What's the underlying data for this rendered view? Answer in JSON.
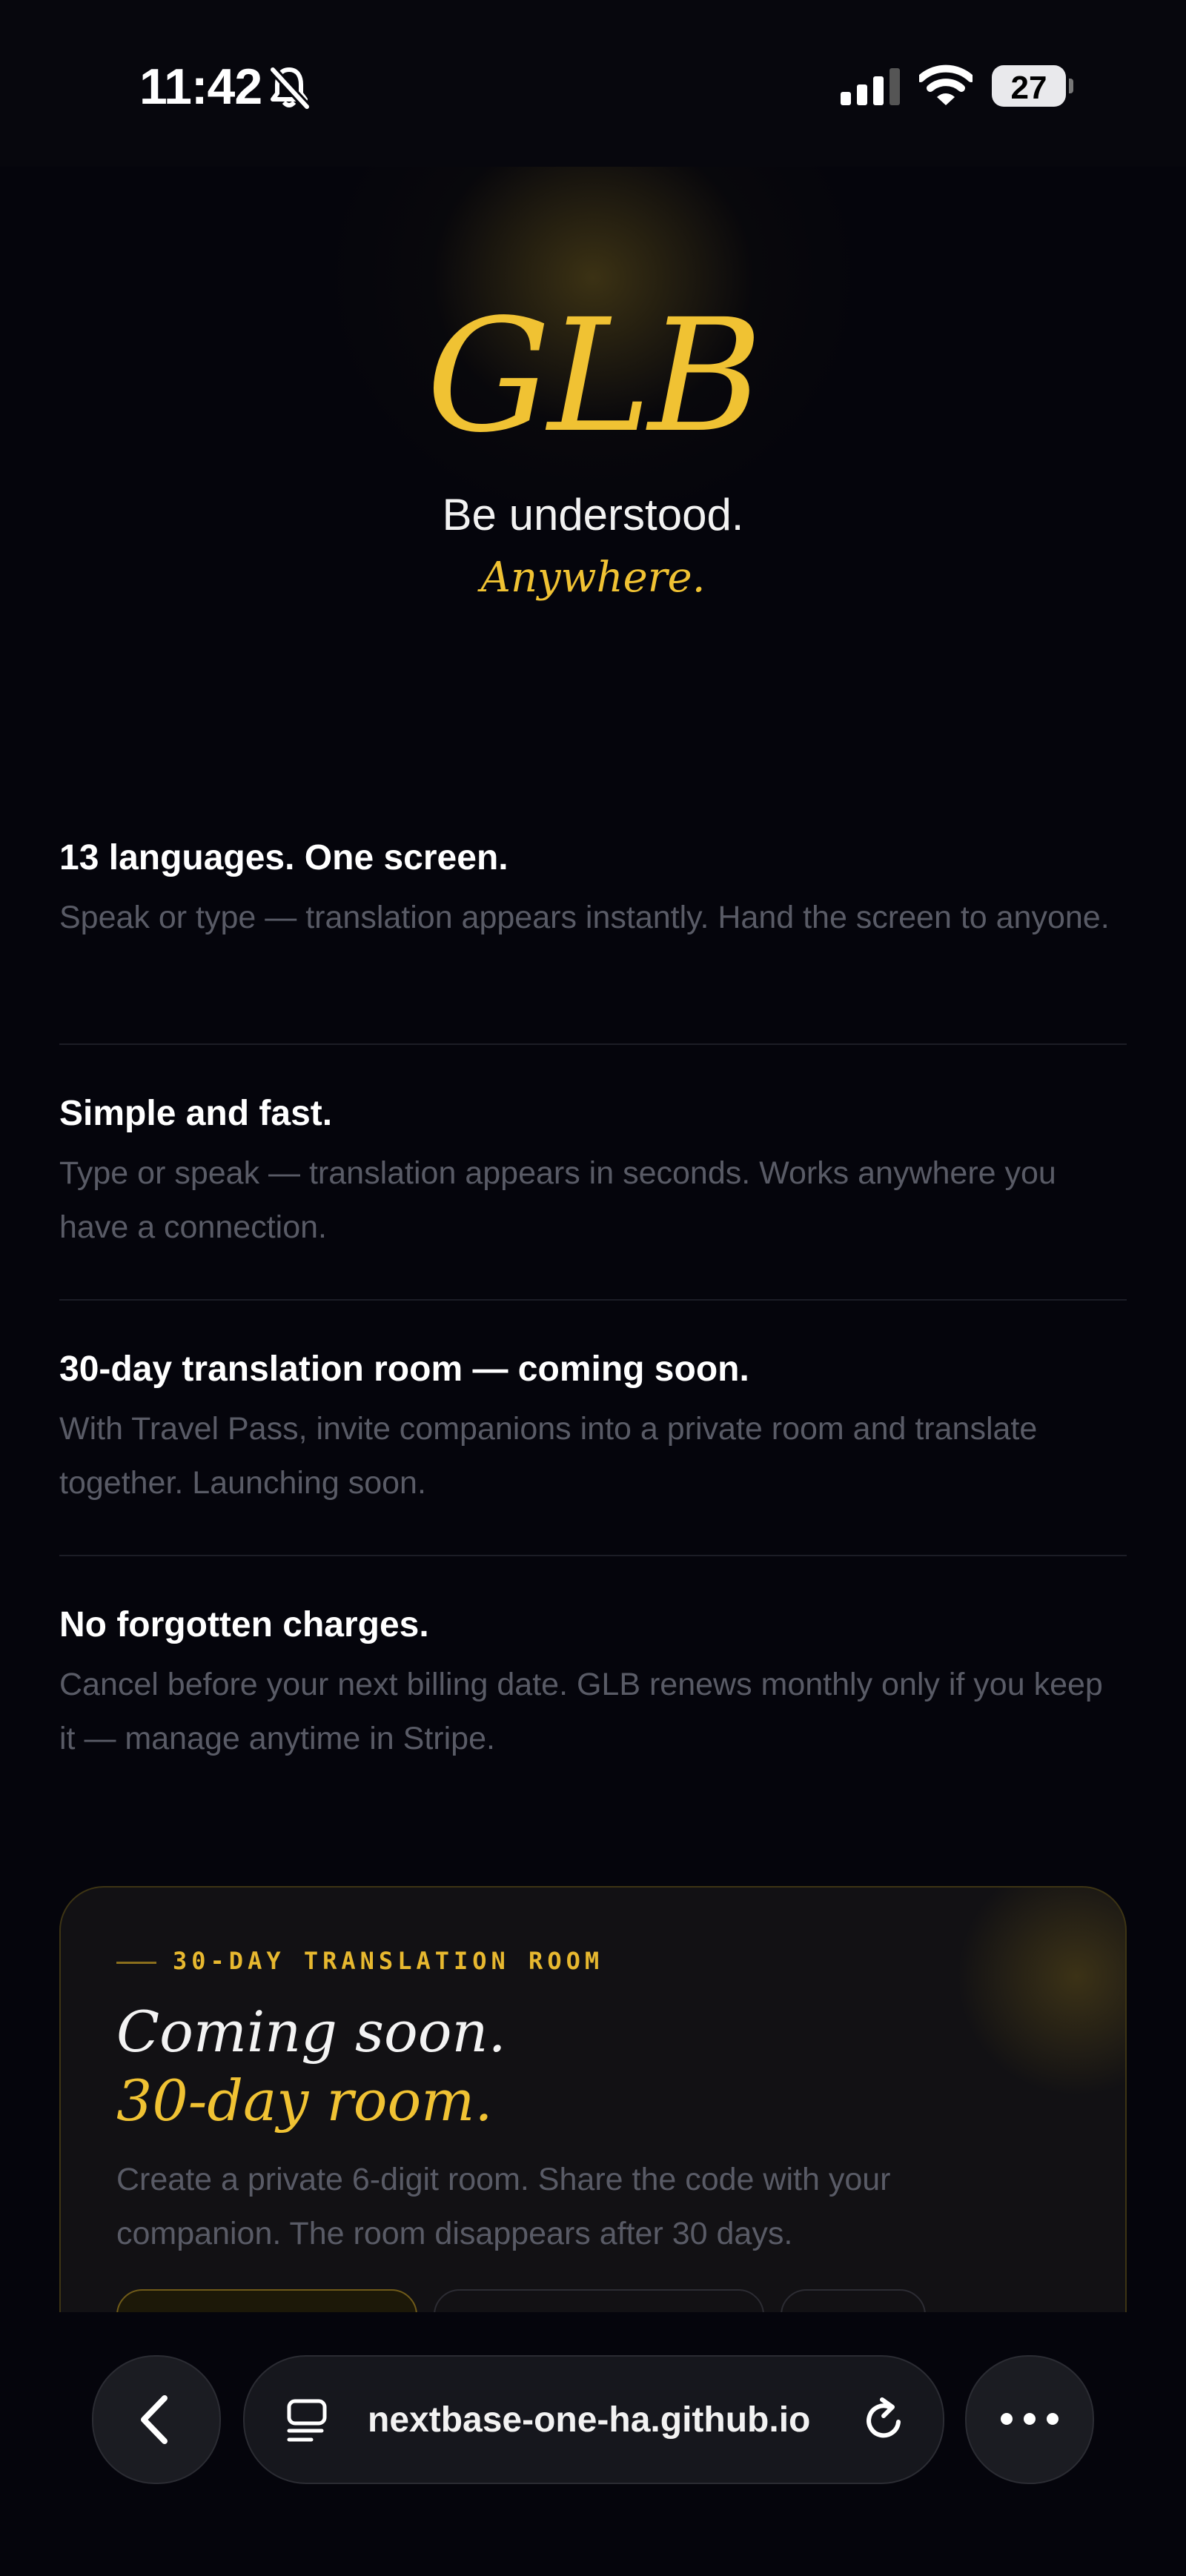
{
  "status": {
    "time": "11:42",
    "battery": "27",
    "icons": [
      "bell-slash-icon",
      "signal-icon",
      "wifi-icon",
      "battery-icon"
    ]
  },
  "hero": {
    "logo": "GLB",
    "tagline": "Be understood.",
    "tagline_accent": "Anywhere."
  },
  "features": [
    {
      "title": "13 languages. One screen.",
      "body": "Speak or type — translation appears instantly. Hand the screen to anyone."
    },
    {
      "title": "Simple and fast.",
      "body": "Type or speak — translation appears in seconds. Works anywhere you have a connection."
    },
    {
      "title": "30-day translation room — coming soon.",
      "body": "With Travel Pass, invite companions into a private room and translate together. Launching soon."
    },
    {
      "title": "No forgotten charges.",
      "body": "Cancel before your next billing date. GLB renews monthly only if you keep it — manage anytime in Stripe."
    }
  ],
  "card": {
    "eyebrow": "30-DAY TRANSLATION ROOM",
    "title": "Coming soon.",
    "title_accent": "30-day room.",
    "description": "Create a private 6-digit room. Share the code with your companion. The room disappears after 30 days."
  },
  "browser": {
    "url": "nextbase-one-ha.github.io"
  },
  "colors": {
    "accent": "#f0c233",
    "background": "#05050c",
    "muted_text": "#595b66"
  }
}
